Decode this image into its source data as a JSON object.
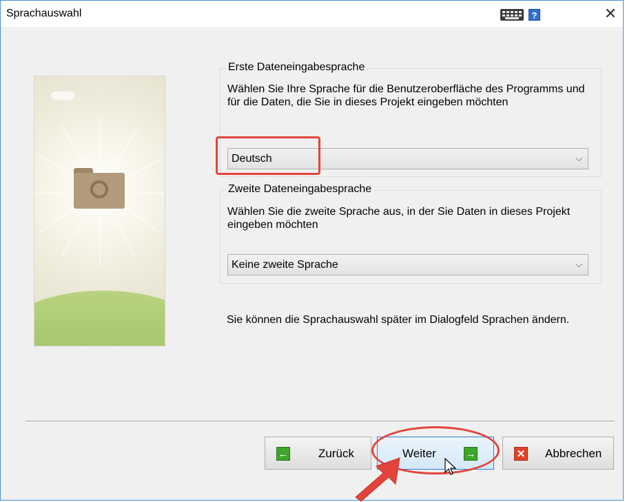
{
  "window": {
    "title": "Sprachauswahl",
    "help_glyph": "?",
    "close_glyph": "✕"
  },
  "first_language": {
    "legend": "Erste Dateneingabesprache",
    "description": "Wählen Sie Ihre Sprache für die Benutzeroberfläche des Programms und für die Daten, die Sie in dieses Projekt eingeben möchten",
    "selected": "Deutsch"
  },
  "second_language": {
    "legend": "Zweite Dateneingabesprache",
    "description": "Wählen Sie die zweite Sprache aus, in der Sie Daten in dieses Projekt eingeben möchten",
    "selected": "Keine zweite Sprache"
  },
  "info_text": "Sie können die Sprachauswahl später im Dialogfeld Sprachen ändern.",
  "buttons": {
    "back": "Zurück",
    "next": "Weiter",
    "cancel": "Abbrechen"
  },
  "icons": {
    "keyboard": "keyboard-icon",
    "help": "help-icon",
    "close": "close-icon",
    "back_arrow": "arrow-left-icon",
    "next_arrow": "arrow-right-icon",
    "cancel_x": "cancel-x-icon",
    "combo_arrow": "chevron-down-icon",
    "folder": "folder-icon"
  },
  "colors": {
    "accent_blue": "#2f7bd0",
    "annotation_red": "#e2443b",
    "green_icon": "#3fa52c",
    "red_icon": "#e4412a"
  }
}
